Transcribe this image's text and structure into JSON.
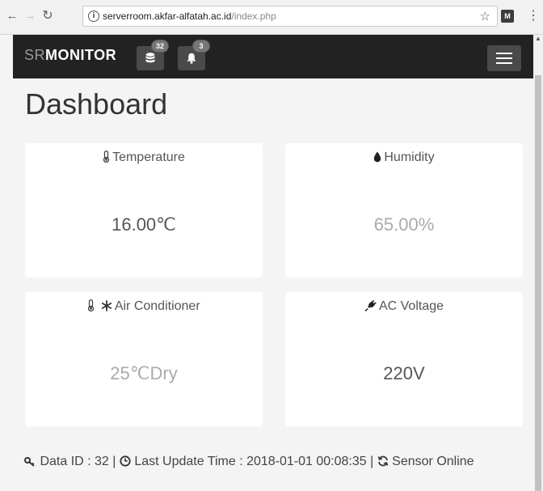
{
  "browser": {
    "url_host": "serverroom.akfar-alfatah.ac.id",
    "url_path": "/index.php",
    "ext_label": "M"
  },
  "navbar": {
    "brand_prefix": "SR",
    "brand_suffix": "MONITOR",
    "database_badge": "32",
    "notification_badge": "3"
  },
  "page": {
    "title": "Dashboard"
  },
  "cards": {
    "temperature": {
      "label": "Temperature",
      "value": "16.00℃"
    },
    "humidity": {
      "label": "Humidity",
      "value": "65.00%"
    },
    "air_conditioner": {
      "label": "Air Conditioner",
      "value": "25℃Dry"
    },
    "ac_voltage": {
      "label": "AC Voltage",
      "value": "220V"
    }
  },
  "footer": {
    "data_id": "Data ID : 32",
    "sep1": "|",
    "last_update": "Last Update Time : 2018-01-01 00:08:35",
    "sep2": "|",
    "sensor_status": "Sensor Online"
  },
  "colors": {
    "navbar_bg": "#222222",
    "page_bg": "#f4f4f4",
    "card_bg": "#ffffff",
    "muted_value": "#aaaaaa"
  }
}
